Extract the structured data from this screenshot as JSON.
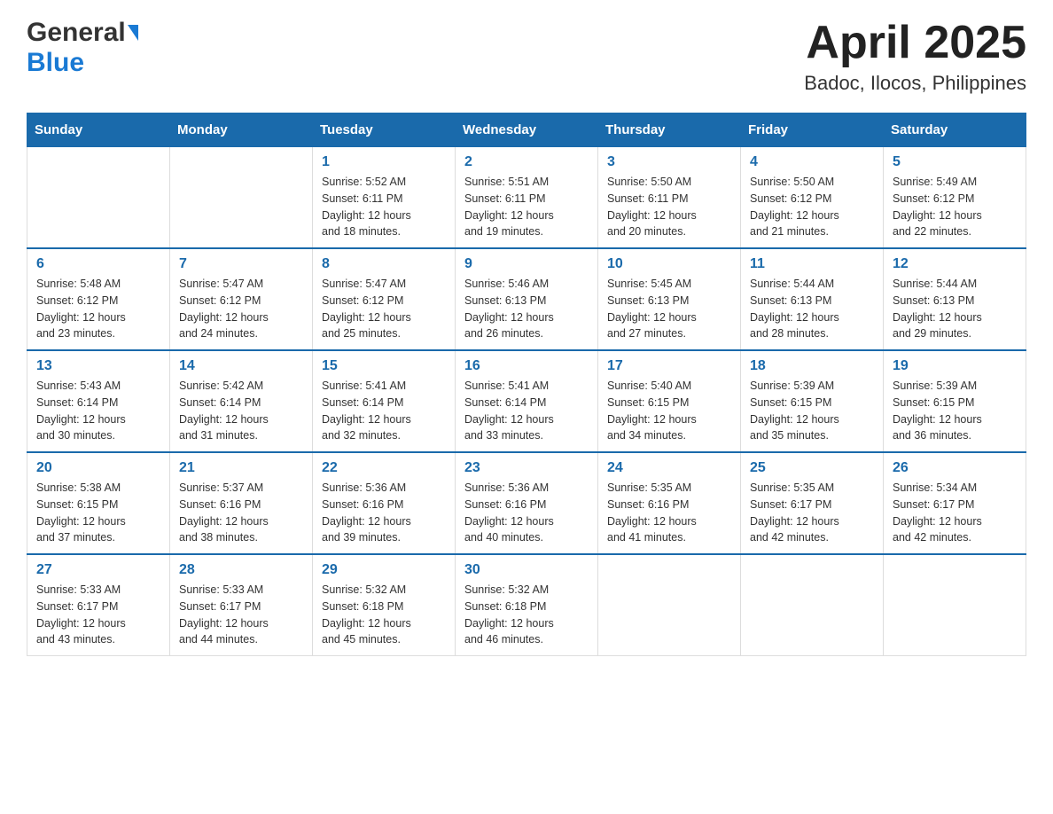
{
  "logo": {
    "general": "General",
    "blue": "Blue"
  },
  "title": "April 2025",
  "subtitle": "Badoc, Ilocos, Philippines",
  "weekdays": [
    "Sunday",
    "Monday",
    "Tuesday",
    "Wednesday",
    "Thursday",
    "Friday",
    "Saturday"
  ],
  "weeks": [
    [
      {
        "day": "",
        "info": ""
      },
      {
        "day": "",
        "info": ""
      },
      {
        "day": "1",
        "info": "Sunrise: 5:52 AM\nSunset: 6:11 PM\nDaylight: 12 hours\nand 18 minutes."
      },
      {
        "day": "2",
        "info": "Sunrise: 5:51 AM\nSunset: 6:11 PM\nDaylight: 12 hours\nand 19 minutes."
      },
      {
        "day": "3",
        "info": "Sunrise: 5:50 AM\nSunset: 6:11 PM\nDaylight: 12 hours\nand 20 minutes."
      },
      {
        "day": "4",
        "info": "Sunrise: 5:50 AM\nSunset: 6:12 PM\nDaylight: 12 hours\nand 21 minutes."
      },
      {
        "day": "5",
        "info": "Sunrise: 5:49 AM\nSunset: 6:12 PM\nDaylight: 12 hours\nand 22 minutes."
      }
    ],
    [
      {
        "day": "6",
        "info": "Sunrise: 5:48 AM\nSunset: 6:12 PM\nDaylight: 12 hours\nand 23 minutes."
      },
      {
        "day": "7",
        "info": "Sunrise: 5:47 AM\nSunset: 6:12 PM\nDaylight: 12 hours\nand 24 minutes."
      },
      {
        "day": "8",
        "info": "Sunrise: 5:47 AM\nSunset: 6:12 PM\nDaylight: 12 hours\nand 25 minutes."
      },
      {
        "day": "9",
        "info": "Sunrise: 5:46 AM\nSunset: 6:13 PM\nDaylight: 12 hours\nand 26 minutes."
      },
      {
        "day": "10",
        "info": "Sunrise: 5:45 AM\nSunset: 6:13 PM\nDaylight: 12 hours\nand 27 minutes."
      },
      {
        "day": "11",
        "info": "Sunrise: 5:44 AM\nSunset: 6:13 PM\nDaylight: 12 hours\nand 28 minutes."
      },
      {
        "day": "12",
        "info": "Sunrise: 5:44 AM\nSunset: 6:13 PM\nDaylight: 12 hours\nand 29 minutes."
      }
    ],
    [
      {
        "day": "13",
        "info": "Sunrise: 5:43 AM\nSunset: 6:14 PM\nDaylight: 12 hours\nand 30 minutes."
      },
      {
        "day": "14",
        "info": "Sunrise: 5:42 AM\nSunset: 6:14 PM\nDaylight: 12 hours\nand 31 minutes."
      },
      {
        "day": "15",
        "info": "Sunrise: 5:41 AM\nSunset: 6:14 PM\nDaylight: 12 hours\nand 32 minutes."
      },
      {
        "day": "16",
        "info": "Sunrise: 5:41 AM\nSunset: 6:14 PM\nDaylight: 12 hours\nand 33 minutes."
      },
      {
        "day": "17",
        "info": "Sunrise: 5:40 AM\nSunset: 6:15 PM\nDaylight: 12 hours\nand 34 minutes."
      },
      {
        "day": "18",
        "info": "Sunrise: 5:39 AM\nSunset: 6:15 PM\nDaylight: 12 hours\nand 35 minutes."
      },
      {
        "day": "19",
        "info": "Sunrise: 5:39 AM\nSunset: 6:15 PM\nDaylight: 12 hours\nand 36 minutes."
      }
    ],
    [
      {
        "day": "20",
        "info": "Sunrise: 5:38 AM\nSunset: 6:15 PM\nDaylight: 12 hours\nand 37 minutes."
      },
      {
        "day": "21",
        "info": "Sunrise: 5:37 AM\nSunset: 6:16 PM\nDaylight: 12 hours\nand 38 minutes."
      },
      {
        "day": "22",
        "info": "Sunrise: 5:36 AM\nSunset: 6:16 PM\nDaylight: 12 hours\nand 39 minutes."
      },
      {
        "day": "23",
        "info": "Sunrise: 5:36 AM\nSunset: 6:16 PM\nDaylight: 12 hours\nand 40 minutes."
      },
      {
        "day": "24",
        "info": "Sunrise: 5:35 AM\nSunset: 6:16 PM\nDaylight: 12 hours\nand 41 minutes."
      },
      {
        "day": "25",
        "info": "Sunrise: 5:35 AM\nSunset: 6:17 PM\nDaylight: 12 hours\nand 42 minutes."
      },
      {
        "day": "26",
        "info": "Sunrise: 5:34 AM\nSunset: 6:17 PM\nDaylight: 12 hours\nand 42 minutes."
      }
    ],
    [
      {
        "day": "27",
        "info": "Sunrise: 5:33 AM\nSunset: 6:17 PM\nDaylight: 12 hours\nand 43 minutes."
      },
      {
        "day": "28",
        "info": "Sunrise: 5:33 AM\nSunset: 6:17 PM\nDaylight: 12 hours\nand 44 minutes."
      },
      {
        "day": "29",
        "info": "Sunrise: 5:32 AM\nSunset: 6:18 PM\nDaylight: 12 hours\nand 45 minutes."
      },
      {
        "day": "30",
        "info": "Sunrise: 5:32 AM\nSunset: 6:18 PM\nDaylight: 12 hours\nand 46 minutes."
      },
      {
        "day": "",
        "info": ""
      },
      {
        "day": "",
        "info": ""
      },
      {
        "day": "",
        "info": ""
      }
    ]
  ]
}
